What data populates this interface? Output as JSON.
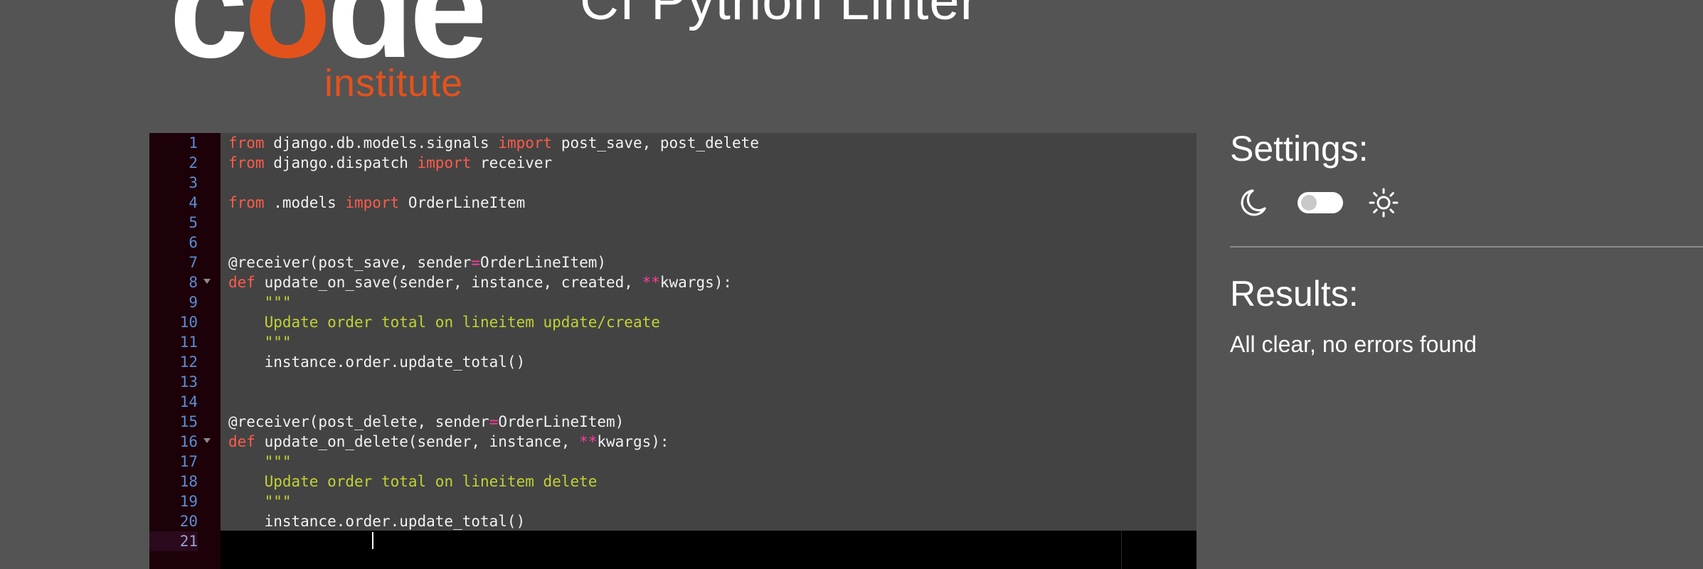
{
  "logo": {
    "word_part1": "c",
    "word_part2": "o",
    "word_part3": "de",
    "subtitle": "institute"
  },
  "header": {
    "title": "CI Python Linter"
  },
  "editor": {
    "active_line": 21,
    "lines": [
      {
        "n": "1",
        "fold": false,
        "tokens": [
          [
            "kw",
            "from"
          ],
          [
            "t",
            " django.db.models.signals "
          ],
          [
            "kw",
            "import"
          ],
          [
            "t",
            " post_save, post_delete"
          ]
        ]
      },
      {
        "n": "2",
        "fold": false,
        "tokens": [
          [
            "kw",
            "from"
          ],
          [
            "t",
            " django.dispatch "
          ],
          [
            "kw",
            "import"
          ],
          [
            "t",
            " receiver"
          ]
        ]
      },
      {
        "n": "3",
        "fold": false,
        "tokens": []
      },
      {
        "n": "4",
        "fold": false,
        "tokens": [
          [
            "kw",
            "from"
          ],
          [
            "t",
            " .models "
          ],
          [
            "kw",
            "import"
          ],
          [
            "t",
            " OrderLineItem"
          ]
        ]
      },
      {
        "n": "5",
        "fold": false,
        "tokens": []
      },
      {
        "n": "6",
        "fold": false,
        "tokens": []
      },
      {
        "n": "7",
        "fold": false,
        "tokens": [
          [
            "t",
            "@receiver(post_save, sender"
          ],
          [
            "op",
            "="
          ],
          [
            "t",
            "OrderLineItem)"
          ]
        ]
      },
      {
        "n": "8",
        "fold": true,
        "tokens": [
          [
            "kw",
            "def"
          ],
          [
            "t",
            " update_on_save(sender, instance, created, "
          ],
          [
            "op",
            "**"
          ],
          [
            "t",
            "kwargs):"
          ]
        ]
      },
      {
        "n": "9",
        "fold": false,
        "tokens": [
          [
            "t",
            "    "
          ],
          [
            "str",
            "\"\"\""
          ]
        ]
      },
      {
        "n": "10",
        "fold": false,
        "tokens": [
          [
            "t",
            "    "
          ],
          [
            "str",
            "Update order total on lineitem update/create"
          ]
        ]
      },
      {
        "n": "11",
        "fold": false,
        "tokens": [
          [
            "t",
            "    "
          ],
          [
            "str",
            "\"\"\""
          ]
        ]
      },
      {
        "n": "12",
        "fold": false,
        "tokens": [
          [
            "t",
            "    instance.order.update_total()"
          ]
        ]
      },
      {
        "n": "13",
        "fold": false,
        "tokens": []
      },
      {
        "n": "14",
        "fold": false,
        "tokens": []
      },
      {
        "n": "15",
        "fold": false,
        "tokens": [
          [
            "t",
            "@receiver(post_delete, sender"
          ],
          [
            "op",
            "="
          ],
          [
            "t",
            "OrderLineItem)"
          ]
        ]
      },
      {
        "n": "16",
        "fold": true,
        "tokens": [
          [
            "kw",
            "def"
          ],
          [
            "t",
            " update_on_delete(sender, instance, "
          ],
          [
            "op",
            "**"
          ],
          [
            "t",
            "kwargs):"
          ]
        ]
      },
      {
        "n": "17",
        "fold": false,
        "tokens": [
          [
            "t",
            "    "
          ],
          [
            "str",
            "\"\"\""
          ]
        ]
      },
      {
        "n": "18",
        "fold": false,
        "tokens": [
          [
            "t",
            "    "
          ],
          [
            "str",
            "Update order total on lineitem delete"
          ]
        ]
      },
      {
        "n": "19",
        "fold": false,
        "tokens": [
          [
            "t",
            "    "
          ],
          [
            "str",
            "\"\"\""
          ]
        ]
      },
      {
        "n": "20",
        "fold": false,
        "tokens": [
          [
            "t",
            "    instance.order.update_total()"
          ]
        ]
      },
      {
        "n": "21",
        "fold": false,
        "tokens": []
      }
    ]
  },
  "settings": {
    "heading": "Settings:",
    "dark_icon": "moon-icon",
    "light_icon": "sun-icon",
    "toggle_state": "off"
  },
  "results": {
    "heading": "Results:",
    "message": "All clear, no errors found"
  },
  "colors": {
    "background": "#545454",
    "brand_orange": "#e4521b",
    "keyword": "#ff5b4a",
    "operator": "#ff3aa0",
    "string": "#c3d233",
    "line_number": "#5d8bd4"
  }
}
